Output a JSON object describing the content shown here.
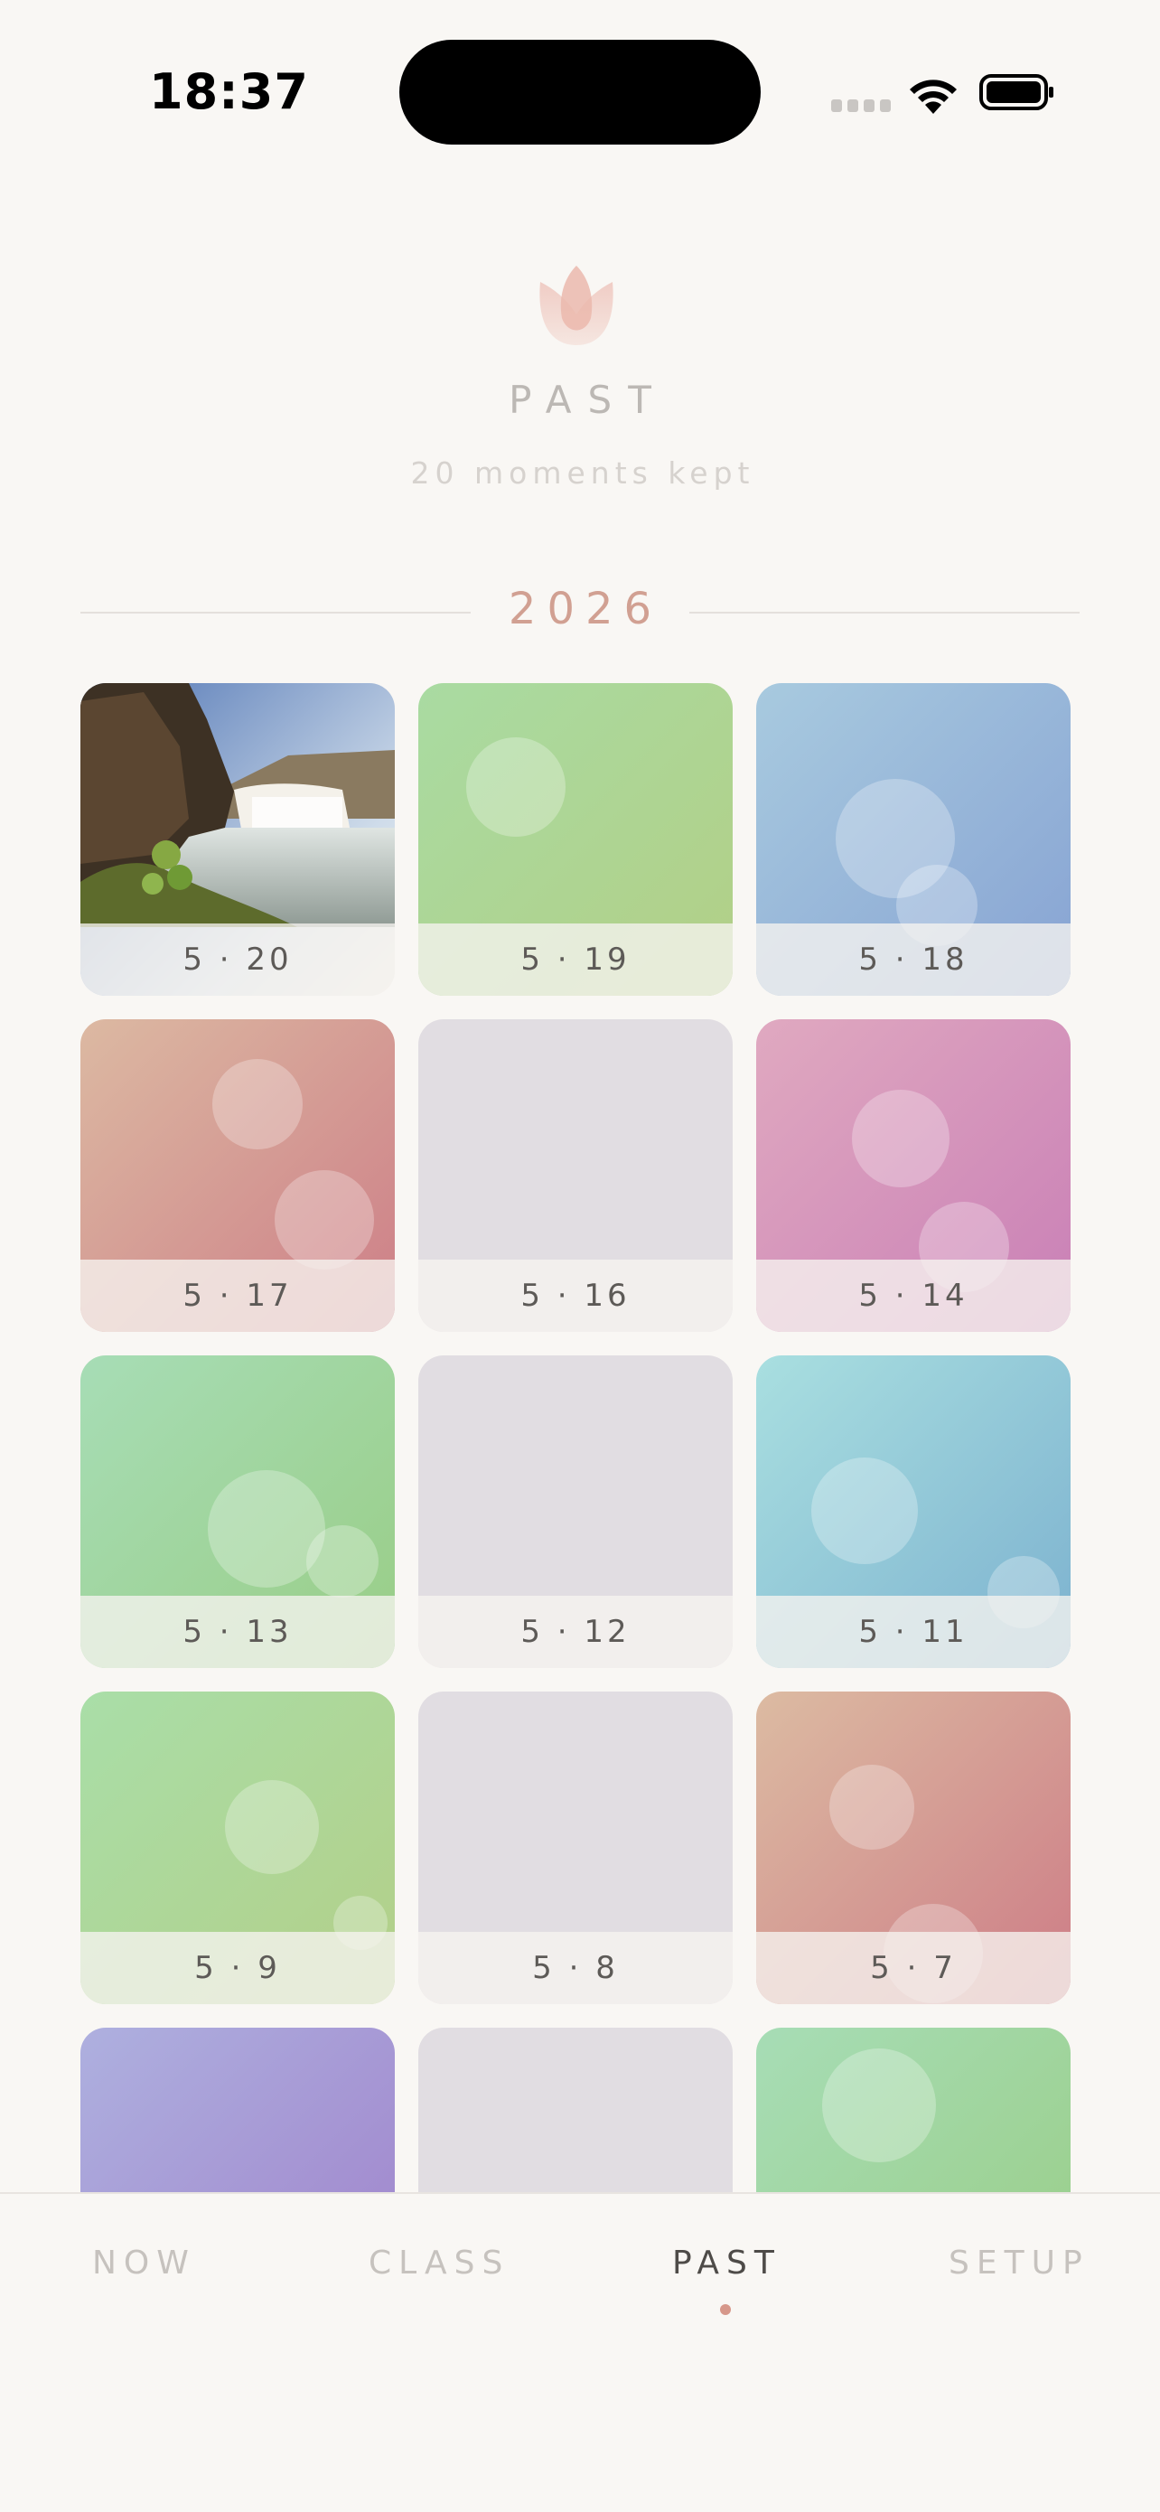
{
  "status_bar": {
    "time": "18:37"
  },
  "header": {
    "icon": "tulip-icon",
    "title": "PAST",
    "subtitle": "20 moments kept"
  },
  "year": "2026",
  "tiles": [
    {
      "date": "5 · 20",
      "type": "photo",
      "photo": "waterfall landscape"
    },
    {
      "date": "5 · 19",
      "type": "gradient",
      "from": "#a9dba2",
      "to": "#b2cf86"
    },
    {
      "date": "5 · 18",
      "type": "gradient",
      "from": "#a8cadf",
      "to": "#87a3d3"
    },
    {
      "date": "5 · 17",
      "type": "gradient",
      "from": "#dcb9a2",
      "to": "#cd7e87"
    },
    {
      "date": "5 · 16",
      "type": "empty",
      "from": "#e1dde2",
      "to": "#e1dde2"
    },
    {
      "date": "5 · 14",
      "type": "gradient",
      "from": "#e0a9c0",
      "to": "#c97fb6"
    },
    {
      "date": "5 · 13",
      "type": "gradient",
      "from": "#a7ddb6",
      "to": "#99cd86"
    },
    {
      "date": "5 · 12",
      "type": "empty",
      "from": "#e1dde2",
      "to": "#e1dde2"
    },
    {
      "date": "5 · 11",
      "type": "gradient",
      "from": "#a9dfe0",
      "to": "#7cb1cf"
    },
    {
      "date": "5 · 9",
      "type": "gradient",
      "from": "#a9dea8",
      "to": "#b3cf88"
    },
    {
      "date": "5 · 8",
      "type": "empty",
      "from": "#e1dde2",
      "to": "#e1dde2"
    },
    {
      "date": "5 · 7",
      "type": "gradient",
      "from": "#dcbba2",
      "to": "#cd7c86"
    },
    {
      "date": "",
      "type": "gradient",
      "from": "#aeb0df",
      "to": "#9f82cb"
    },
    {
      "date": "",
      "type": "empty",
      "from": "#e1dde2",
      "to": "#e1dde2"
    },
    {
      "date": "",
      "type": "gradient",
      "from": "#a7ddb6",
      "to": "#99cd86"
    }
  ],
  "tab_bar": {
    "tabs": [
      {
        "label": "NOW"
      },
      {
        "label": "CLASS"
      },
      {
        "label": "PAST",
        "active": true
      },
      {
        "label": "SETUP"
      }
    ]
  }
}
